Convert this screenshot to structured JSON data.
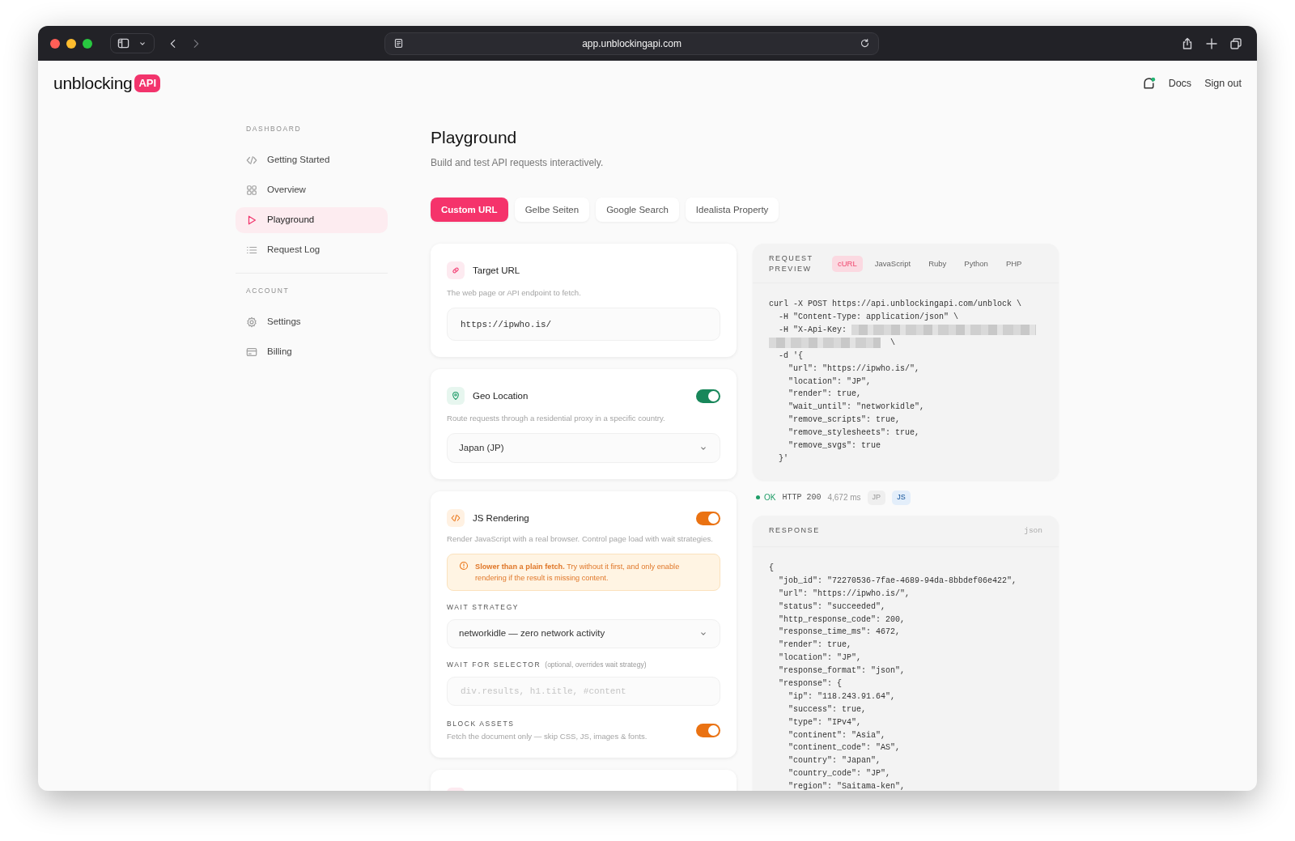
{
  "browser": {
    "url": "app.unblockingapi.com"
  },
  "header": {
    "logo": "unblocking",
    "logo_badge": "API",
    "links": [
      "Docs",
      "Sign out"
    ]
  },
  "sidebar": {
    "sections": [
      {
        "title": "DASHBOARD",
        "items": [
          {
            "label": "Getting Started",
            "kind": "code",
            "selected": false
          },
          {
            "label": "Overview",
            "kind": "grid",
            "selected": false
          },
          {
            "label": "Playground",
            "kind": "play",
            "selected": true
          },
          {
            "label": "Request Log",
            "kind": "list",
            "selected": false
          }
        ]
      },
      {
        "title": "ACCOUNT",
        "items": [
          {
            "label": "Settings",
            "kind": "gear",
            "selected": false
          },
          {
            "label": "Billing",
            "kind": "card",
            "selected": false
          }
        ]
      }
    ]
  },
  "page": {
    "title": "Playground",
    "subtitle": "Build and test API requests interactively."
  },
  "tabs": [
    {
      "label": "Custom URL",
      "selected": true
    },
    {
      "label": "Gelbe Seiten",
      "selected": false
    },
    {
      "label": "Google Search",
      "selected": false
    },
    {
      "label": "Idealista Property",
      "selected": false
    }
  ],
  "cards": [
    {
      "kind": "target",
      "title": "Target URL",
      "description": "The web page or API endpoint to fetch.",
      "value": "https://ipwho.is/"
    },
    {
      "kind": "geo",
      "title": "Geo Location",
      "on": true,
      "description": "Route requests through a residential proxy in a specific country.",
      "select": "Japan (JP)"
    },
    {
      "kind": "js",
      "title": "JS Rendering",
      "on": true,
      "description": "Render JavaScript with a real browser. Control page load with wait strategies.",
      "warning": "**Slower than a plain fetch.** Try without it first, and only enable rendering if the result is missing content.",
      "wait_strategy": {
        "label": "WAIT STRATEGY",
        "value": "networkidle — zero network activity"
      },
      "selector": {
        "label": "WAIT FOR SELECTOR",
        "hint": "(optional, overrides wait strategy)",
        "placeholder": "div.results, h1.title, #content"
      },
      "block_assets": {
        "label": "BLOCK ASSETS",
        "description": "Fetch the document only — skip CSS, JS, images & fonts.",
        "on": true
      }
    }
  ],
  "request_preview": {
    "title": "REQUEST PREVIEW",
    "languages": [
      {
        "label": "cURL",
        "selected": true
      },
      {
        "label": "JavaScript",
        "selected": false
      },
      {
        "label": "Ruby",
        "selected": false
      },
      {
        "label": "Python",
        "selected": false
      },
      {
        "label": "PHP",
        "selected": false
      }
    ],
    "lines": [
      {
        "kind": "text",
        "text": "curl -X POST https://api.unblockingapi.com/unblock \\"
      },
      {
        "kind": "text",
        "text": "  -H \"Content-Type: application/json\" \\"
      },
      {
        "kind": "redacted_tail",
        "text": "  -H \"X-Api-Key: "
      },
      {
        "kind": "redacted_head",
        "text": "\\"
      },
      {
        "kind": "text",
        "text": "  -d '{"
      },
      {
        "kind": "text",
        "text": "    \"url\": \"https://ipwho.is/\","
      },
      {
        "kind": "text",
        "text": "    \"location\": \"JP\","
      },
      {
        "kind": "text",
        "text": "    \"render\": true,"
      },
      {
        "kind": "text",
        "text": "    \"wait_until\": \"networkidle\","
      },
      {
        "kind": "text",
        "text": "    \"remove_scripts\": true,"
      },
      {
        "kind": "text",
        "text": "    \"remove_stylesheets\": true,"
      },
      {
        "kind": "text",
        "text": "    \"remove_svgs\": true"
      },
      {
        "kind": "text",
        "text": "  }'"
      }
    ]
  },
  "status": {
    "kind": "ok",
    "label": "OK",
    "http": "HTTP 200",
    "time": "4,672 ms",
    "tags": [
      {
        "label": "JP",
        "color": "#efefef"
      },
      {
        "label": "JS",
        "color": "#e3eefa"
      }
    ]
  },
  "response": {
    "title": "RESPONSE",
    "format": "json",
    "lines": [
      "{",
      "  \"job_id\": \"72270536-7fae-4689-94da-8bbdef06e422\",",
      "  \"url\": \"https://ipwho.is/\",",
      "  \"status\": \"succeeded\",",
      "  \"http_response_code\": 200,",
      "  \"response_time_ms\": 4672,",
      "  \"render\": true,",
      "  \"location\": \"JP\",",
      "  \"response_format\": \"json\",",
      "  \"response\": {",
      "    \"ip\": \"118.243.91.64\",",
      "    \"success\": true,",
      "    \"type\": \"IPv4\",",
      "    \"continent\": \"Asia\",",
      "    \"continent_code\": \"AS\",",
      "    \"country\": \"Japan\",",
      "    \"country_code\": \"JP\",",
      "    \"region\": \"Saitama-ken\","
    ]
  }
}
